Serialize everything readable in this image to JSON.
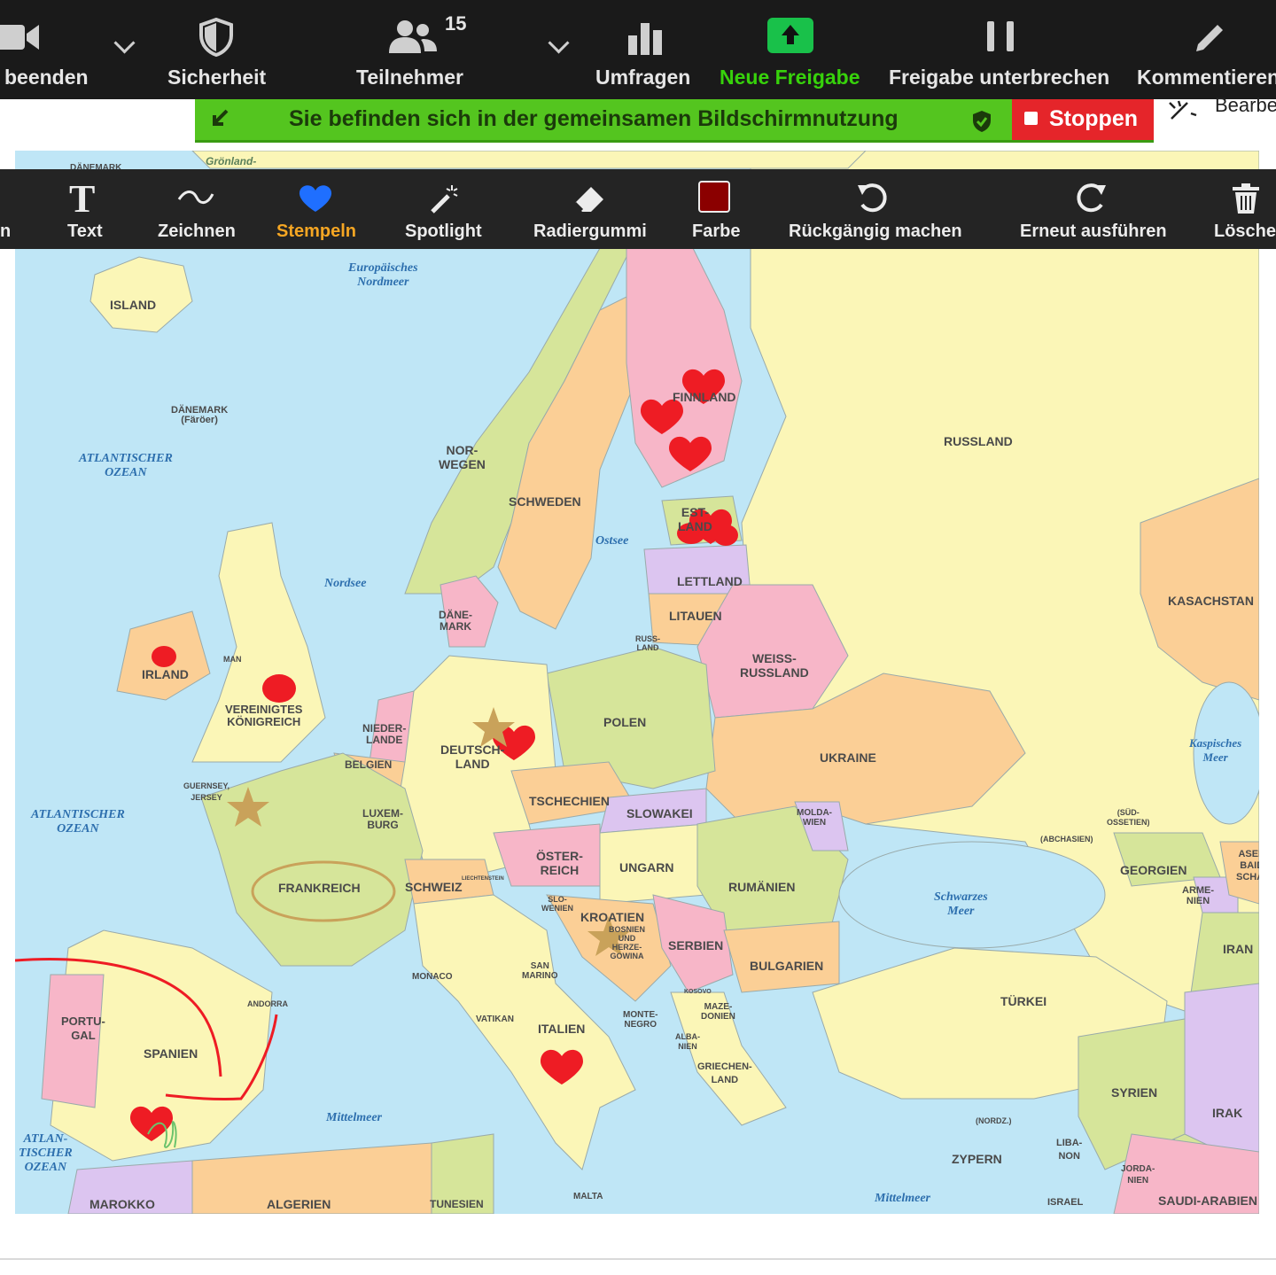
{
  "toolbar": {
    "end_label": "beenden",
    "security_label": "Sicherheit",
    "participants_label": "Teilnehmer",
    "participants_count": "15",
    "polls_label": "Umfragen",
    "new_share_label": "Neue Freigabe",
    "pause_share_label": "Freigabe unterbrechen",
    "annotate_label": "Kommentieren"
  },
  "banner": {
    "text": "Sie befinden sich in der gemeinsamen Bildschirmnutzung",
    "stop_label": "Stoppen",
    "edit_peek": "Bearbe"
  },
  "annotate": {
    "partial_left": "n",
    "text_label": "Text",
    "draw_label": "Zeichnen",
    "stamp_label": "Stempeln",
    "spotlight_label": "Spotlight",
    "eraser_label": "Radiergummi",
    "color_label": "Farbe",
    "undo_label": "Rückgängig machen",
    "redo_label": "Erneut ausführen",
    "clear_label": "Löschen",
    "selected_color": "#8b0000",
    "active_tool_color": "#f5a623"
  },
  "map": {
    "countries": {
      "island": "ISLAND",
      "norwegen": "NOR-\nWEGEN",
      "schweden": "SCHWEDEN",
      "finnland": "FINNLAND",
      "russland": "RUSSLAND",
      "estland": "EST-\nLAND",
      "lettland": "LETTLAND",
      "litauen": "LITAUEN",
      "russ_land": "RUSS-\nLAND",
      "weissrussland": "WEISS-\nRUSSLAND",
      "kasachstan": "KASACHSTAN",
      "daenemark": "DÄNE-\nMARK",
      "irland": "IRLAND",
      "vk": "VEREINIGTES\nKÖNIGREICH",
      "man": "MAN",
      "niederlande": "NIEDER-\nLANDE",
      "belgien": "BELGIEN",
      "deutschland": "DEUTSCH-\nLAND",
      "polen": "POLEN",
      "ukraine": "UKRAINE",
      "luxemburg": "LUXEM-\nBURG",
      "tschechien": "TSCHECHIEN",
      "slowakei": "SLOWAKEI",
      "moldawien": "MOLDA-\nWIEN",
      "oesterreich": "ÖSTER-\nREICH",
      "ungarn": "UNGARN",
      "frankreich": "FRANKREICH",
      "schweiz": "SCHWEIZ",
      "liechtenstein": "LIECHTENSTEIN",
      "rumaenien": "RUMÄNIEN",
      "slowenien": "SLO-\nWENIEN",
      "kroatien": "KROATIEN",
      "bosnien": "BOSNIEN\nUND\nHERZE-\nGOWINA",
      "serbien": "SERBIEN",
      "bulgarien": "BULGARIEN",
      "georgien": "GEORGIEN",
      "armenien": "ARME-\nNIEN",
      "aserbaidschan": "ASER-\nBAID-\nSCHAN",
      "iran": "IRAN",
      "suedossetien": "(SÜD-\nOSSETIEN)",
      "abchasien": "(ABCHASIEN)",
      "monaco": "MONACO",
      "andorra": "ANDORRA",
      "san_marino": "SAN\nMARINO",
      "vatikan": "VATIKAN",
      "italien": "ITALIEN",
      "montenegro": "MONTE-\nNEGRO",
      "kosovo": "KOSOVO",
      "mazedonien": "MAZE-\nDONIEN",
      "albanien": "ALBA-\nNIEN",
      "griechenland": "GRIECHEN-\nLAND",
      "tuerkei": "TÜRKEI",
      "portugal": "PORTU-\nGAL",
      "spanien": "SPANIEN",
      "marokko": "MAROKKO",
      "algerien": "ALGERIEN",
      "tunesien": "TUNESIEN",
      "malta": "MALTA",
      "syrien": "SYRIEN",
      "irak": "IRAK",
      "zypern": "ZYPERN",
      "nordzypern": "(NORDZ.)",
      "libanon": "LIBA-\nNON",
      "jordanien": "JORDA-\nNIEN",
      "israel": "ISRAEL",
      "saudi": "SAUDI-ARABIEN",
      "guernsey": "GUERNSEY,\nJERSEY",
      "daenemark_faroer": "DÄNEMARK\n(Färöer)",
      "groenland": "Grönland-",
      "daenemark_top": "DÄNEMARK"
    },
    "seas": {
      "nordmeer": "Europäisches\nNordmeer",
      "atlantik1": "ATLANTISCHER\nOZEAN",
      "atlantik2": "ATLANTISCHER\nOZEAN",
      "atlantik3": "ATLAN-\nTISCHER\nOZEAN",
      "nordsee": "Nordsee",
      "ostsee": "Ostsee",
      "schwarzes": "Schwarzes\nMeer",
      "kaspisch": "Kaspisches\nMeer",
      "mittelmeer1": "Mittelmeer",
      "mittelmeer2": "Mittelmeer"
    },
    "colors": {
      "sea": "#bfe6f6",
      "yellow": "#fbf6b7",
      "orange": "#fbcf96",
      "pink": "#f7b6c8",
      "green": "#d6e59a",
      "purple": "#dcc5f0",
      "stamp_red": "#ee1c24",
      "stamp_gold": "#c9a25a"
    }
  }
}
